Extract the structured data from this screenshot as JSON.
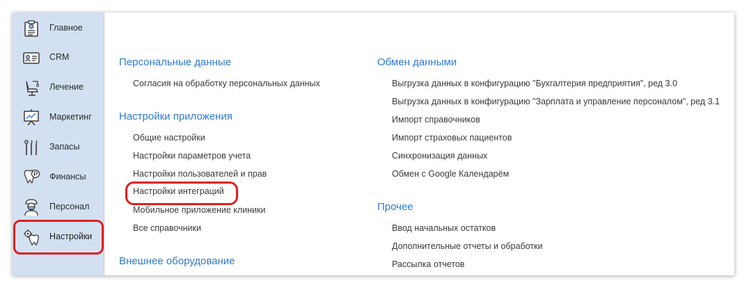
{
  "sidebar": {
    "items": [
      {
        "label": "Главное",
        "icon": "home-list-icon"
      },
      {
        "label": "CRM",
        "icon": "crm-card-icon"
      },
      {
        "label": "Лечение",
        "icon": "dental-chair-icon"
      },
      {
        "label": "Маркетинг",
        "icon": "presentation-board-icon"
      },
      {
        "label": "Запасы",
        "icon": "dental-tools-icon"
      },
      {
        "label": "Финансы",
        "icon": "tooth-coin-icon"
      },
      {
        "label": "Персонал",
        "icon": "doctor-icon"
      },
      {
        "label": "Настройки",
        "icon": "tooth-gear-icon"
      }
    ],
    "active_index": 7
  },
  "main": {
    "left": {
      "personal": {
        "title": "Персональные данные",
        "links": [
          "Согласия на обработку персональных данных"
        ]
      },
      "app_settings": {
        "title": "Настройки приложения",
        "links": [
          "Общие настройки",
          "Настройки параметров учета",
          "Настройки пользователей и прав",
          "Настройки интеграций",
          "Мобильное приложение клиники",
          "Все справочники"
        ]
      },
      "equipment": {
        "title": "Внешнее оборудование"
      }
    },
    "right": {
      "exchange": {
        "title": "Обмен данными",
        "links": [
          "Выгрузка данных в конфигурацию \"Бухгалтерия предприятия\", ред 3.0",
          "Выгрузка данных в конфигурацию \"Зарплата и управление персоналом\", ред 3.1",
          "Импорт справочников",
          "Импорт страховых пациентов",
          "Синхронизация данных",
          "Обмен с Google Календарём"
        ]
      },
      "other": {
        "title": "Прочее",
        "links": [
          "Ввод начальных остатков",
          "Дополнительные отчеты и обработки",
          "Рассылка отчетов"
        ]
      }
    }
  },
  "colors": {
    "sidebar_bg": "#d3e0f2",
    "section_title": "#2f7ad0",
    "link_text": "#3a3a3a",
    "highlight": "#e01e1e"
  }
}
